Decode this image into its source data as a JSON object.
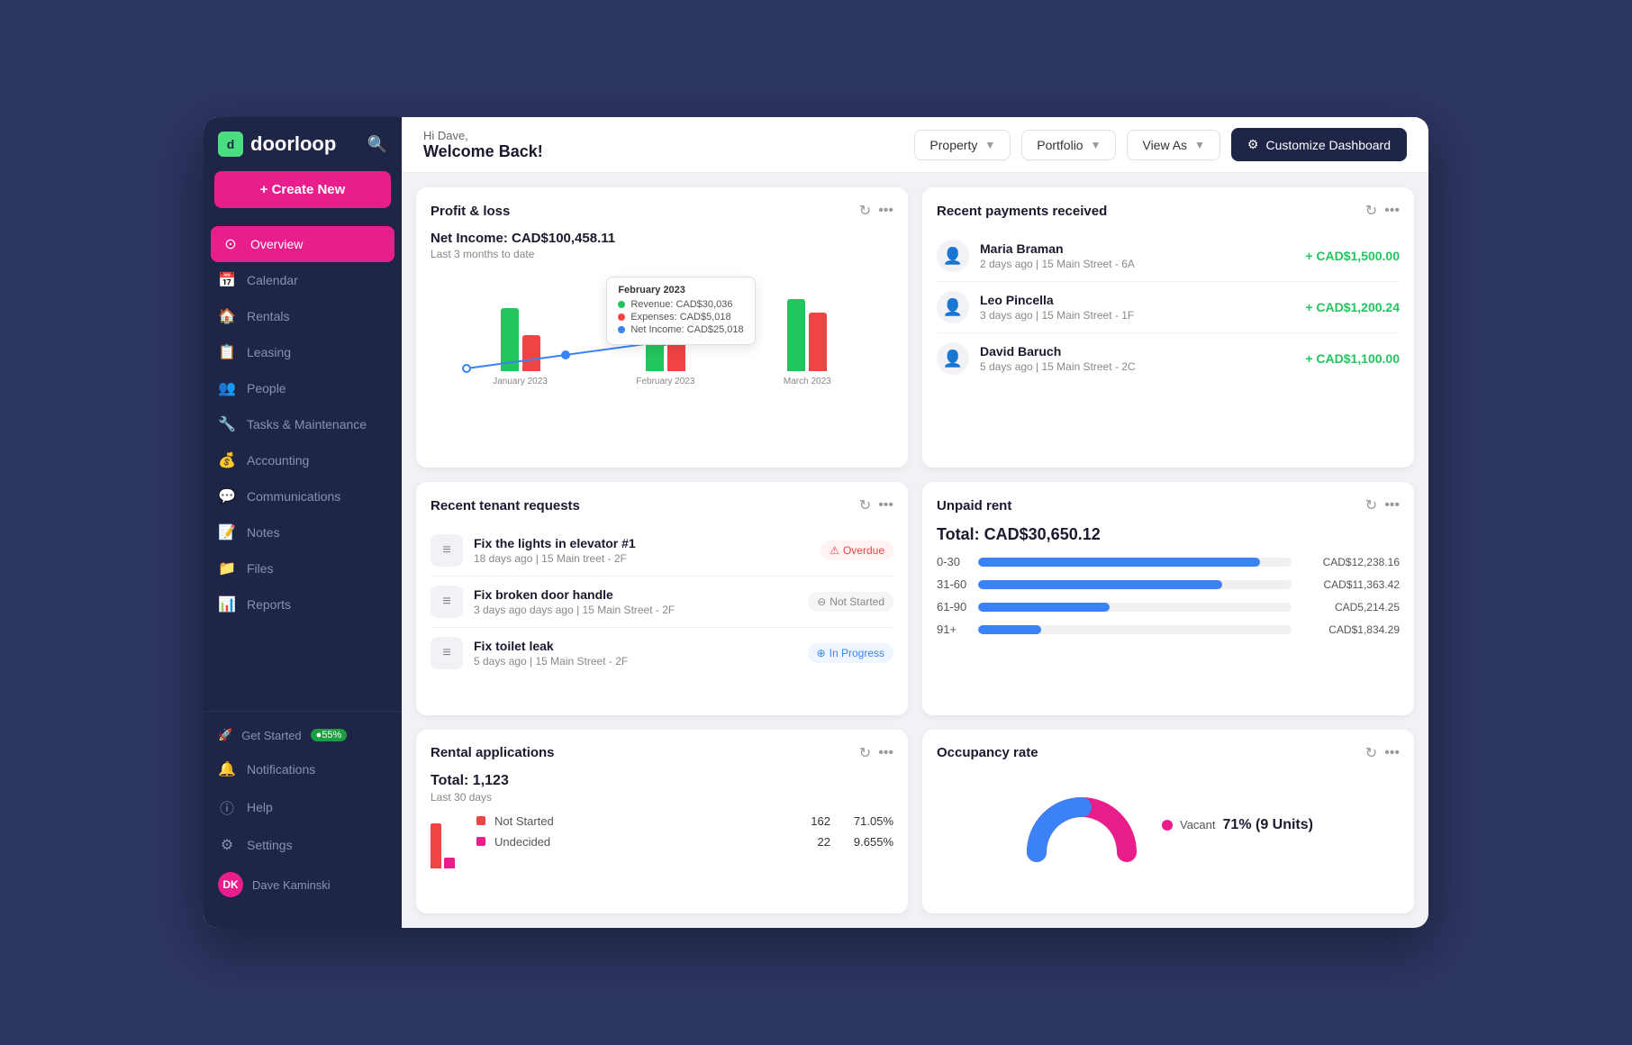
{
  "app": {
    "name": "doorloop"
  },
  "sidebar": {
    "logo": "doorloop",
    "create_new_label": "+ Create New",
    "nav_items": [
      {
        "id": "overview",
        "label": "Overview",
        "icon": "⊙",
        "active": true
      },
      {
        "id": "calendar",
        "label": "Calendar",
        "icon": "📅"
      },
      {
        "id": "rentals",
        "label": "Rentals",
        "icon": "🏠"
      },
      {
        "id": "leasing",
        "label": "Leasing",
        "icon": "📋"
      },
      {
        "id": "people",
        "label": "People",
        "icon": "👥"
      },
      {
        "id": "tasks",
        "label": "Tasks & Maintenance",
        "icon": "🔧"
      },
      {
        "id": "accounting",
        "label": "Accounting",
        "icon": "💰"
      },
      {
        "id": "communications",
        "label": "Communications",
        "icon": "💬"
      },
      {
        "id": "notes",
        "label": "Notes",
        "icon": "📝"
      },
      {
        "id": "files",
        "label": "Files",
        "icon": "📁"
      },
      {
        "id": "reports",
        "label": "Reports",
        "icon": "📊"
      }
    ],
    "bottom_items": [
      {
        "id": "get-started",
        "label": "Get Started",
        "progress": "55%"
      },
      {
        "id": "notifications",
        "label": "Notifications"
      },
      {
        "id": "help",
        "label": "Help"
      },
      {
        "id": "settings",
        "label": "Settings"
      }
    ],
    "user": {
      "name": "Dave Kaminski",
      "initials": "DK"
    }
  },
  "topbar": {
    "greeting": "Hi Dave,",
    "welcome": "Welcome Back!",
    "property_label": "Property",
    "portfolio_label": "Portfolio",
    "view_as_label": "View As",
    "customize_label": "Customize Dashboard"
  },
  "profit_loss": {
    "title": "Profit & loss",
    "net_income_label": "Net Income: CAD$100,458.11",
    "period": "Last 3 months to date",
    "tooltip_month": "February 2023",
    "tooltip_revenue": "Revenue: CAD$30,036",
    "tooltip_expenses": "Expenses: CAD$5,018",
    "tooltip_net": "Net Income: CAD$25,018",
    "bars": [
      {
        "month": "January 2023",
        "revenue_h": 70,
        "expense_h": 40
      },
      {
        "month": "February 2023",
        "revenue_h": 55,
        "expense_h": 35
      },
      {
        "month": "March 2023",
        "revenue_h": 80,
        "expense_h": 65
      }
    ],
    "line_points": "10,90 120,65 230,50"
  },
  "recent_payments": {
    "title": "Recent payments received",
    "items": [
      {
        "name": "Maria Braman",
        "meta": "2 days ago | 15 Main Street - 6A",
        "amount": "+ CAD$1,500.00"
      },
      {
        "name": "Leo Pincella",
        "meta": "3 days ago | 15 Main Street - 1F",
        "amount": "+ CAD$1,200.24"
      },
      {
        "name": "David Baruch",
        "meta": "5 days ago | 15 Main Street - 2C",
        "amount": "+ CAD$1,100.00"
      }
    ]
  },
  "tenant_requests": {
    "title": "Recent tenant requests",
    "items": [
      {
        "title": "Fix the lights in elevator #1",
        "meta": "18 days ago | 15 Main treet - 2F",
        "status": "Overdue",
        "status_type": "overdue"
      },
      {
        "title": "Fix broken door handle",
        "meta": "3 days ago days ago | 15 Main Street - 2F",
        "status": "Not Started",
        "status_type": "not-started"
      },
      {
        "title": "Fix toilet leak",
        "meta": "5 days ago | 15 Main Street - 2F",
        "status": "In Progress",
        "status_type": "in-progress"
      }
    ]
  },
  "unpaid_rent": {
    "title": "Unpaid rent",
    "total": "Total: CAD$30,650.12",
    "rows": [
      {
        "label": "0-30",
        "amount": "CAD$12,238.16",
        "pct": 90
      },
      {
        "label": "31-60",
        "amount": "CAD$11,363.42",
        "pct": 78
      },
      {
        "label": "61-90",
        "amount": "CAD5,214.25",
        "pct": 42
      },
      {
        "label": "91+",
        "amount": "CAD$1,834.29",
        "pct": 20
      }
    ]
  },
  "rental_applications": {
    "title": "Rental applications",
    "total": "Total: 1,123",
    "period": "Last 30 days",
    "rows": [
      {
        "label": "Not Started",
        "count": "162",
        "pct": "71.05%",
        "color": "#ef4444"
      },
      {
        "label": "Undecided",
        "count": "22",
        "pct": "9.655%",
        "color": "#e91e8c"
      }
    ]
  },
  "occupancy_rate": {
    "title": "Occupancy rate",
    "vacant_label": "Vacant",
    "vacant_pct": "71% (9 Units)",
    "occupied_color": "#3b82f6",
    "vacant_color": "#e91e8c"
  }
}
